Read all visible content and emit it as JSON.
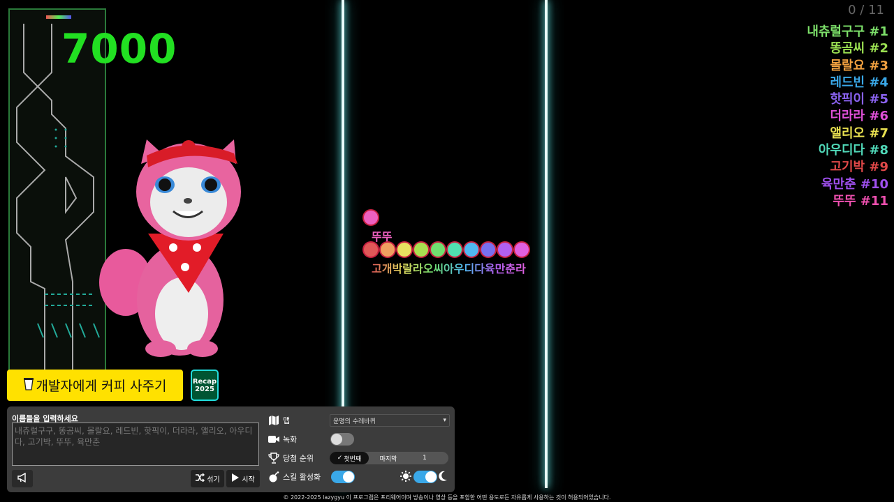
{
  "hud": {
    "score": "7000",
    "counter": "0 / 11"
  },
  "ranking": [
    {
      "label": "내츄럴구구 #1",
      "color": "#7de06a"
    },
    {
      "label": "똥곰씨 #2",
      "color": "#9be052"
    },
    {
      "label": "몰랄요 #3",
      "color": "#f0a040"
    },
    {
      "label": "레드빈 #4",
      "color": "#3aa8e8"
    },
    {
      "label": "핫픽이 #5",
      "color": "#8a62f0"
    },
    {
      "label": "더라라 #6",
      "color": "#e050d8"
    },
    {
      "label": "앨리오 #7",
      "color": "#e8e050"
    },
    {
      "label": "아우디다 #8",
      "color": "#50d8b8"
    },
    {
      "label": "고기박 #9",
      "color": "#e04848"
    },
    {
      "label": "육만춘 #10",
      "color": "#a050f0"
    },
    {
      "label": "뚜뚜 #11",
      "color": "#f050b0"
    }
  ],
  "game": {
    "lead_marble_label": "뚜뚜",
    "lead_marble_color": "#ee60c0",
    "cluster_label": "고개박랄라오씨아우디다육만춘라",
    "marble_colors": [
      "#e05858",
      "#f0a060",
      "#e8e060",
      "#a8e050",
      "#70e070",
      "#50e0b0",
      "#50b8f0",
      "#7870f0",
      "#b060f0",
      "#e060e0"
    ]
  },
  "buttons": {
    "coffee": "개발자에게 커피 사주기",
    "recap_line1": "Recap",
    "recap_line2": "2025",
    "shuffle": "섞기",
    "start": "시작"
  },
  "panel": {
    "name_label": "이름들을 입력하세요",
    "names_value": "내츄럴구구, 똥곰씨, 몰랄요, 레드빈, 핫픽이, 더라라, 앨리오, 아우디다, 고기박, 뚜뚜, 육만춘",
    "map_label": "맵",
    "map_value": "운명의 수레바퀴",
    "record_label": "녹화",
    "record_on": false,
    "winner_rank_label": "당첨 순위",
    "winner_first": "첫번째",
    "winner_last": "마지막",
    "winner_number": "1",
    "skill_label": "스킬 활성화",
    "skill_on": true,
    "theme_dark": true
  },
  "footer": "© 2022-2025 lazygyu 이 프로그램은 프리웨어이며 방송이나 영상 등을 포함한 어떤 용도로든 자유롭게 사용하는 것이 허용되어있습니다."
}
